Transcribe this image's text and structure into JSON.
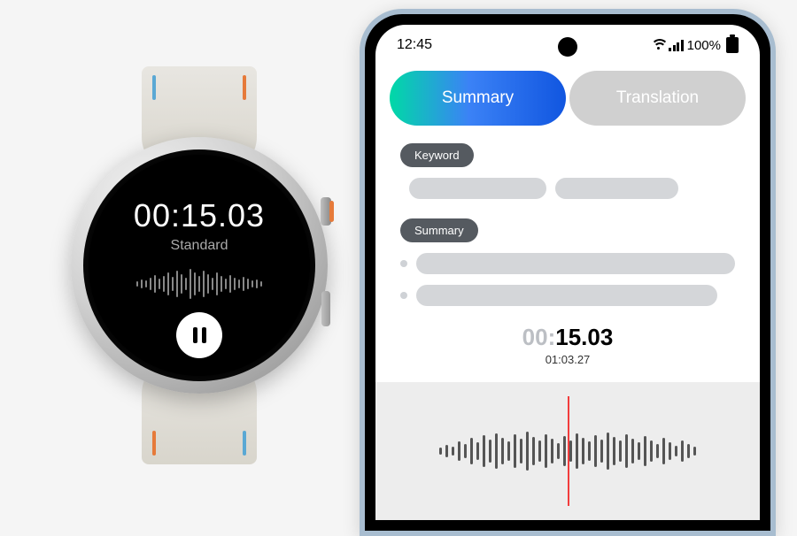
{
  "watch": {
    "time": "00:15.03",
    "mode": "Standard"
  },
  "phone": {
    "status": {
      "clock": "12:45",
      "battery_text": "100%"
    },
    "tabs": {
      "summary": "Summary",
      "translation": "Translation"
    },
    "labels": {
      "keyword": "Keyword",
      "summary": "Summary"
    },
    "playback": {
      "elapsed_prefix": "00:",
      "elapsed_main": "15.03",
      "total": "01:03.27"
    }
  }
}
